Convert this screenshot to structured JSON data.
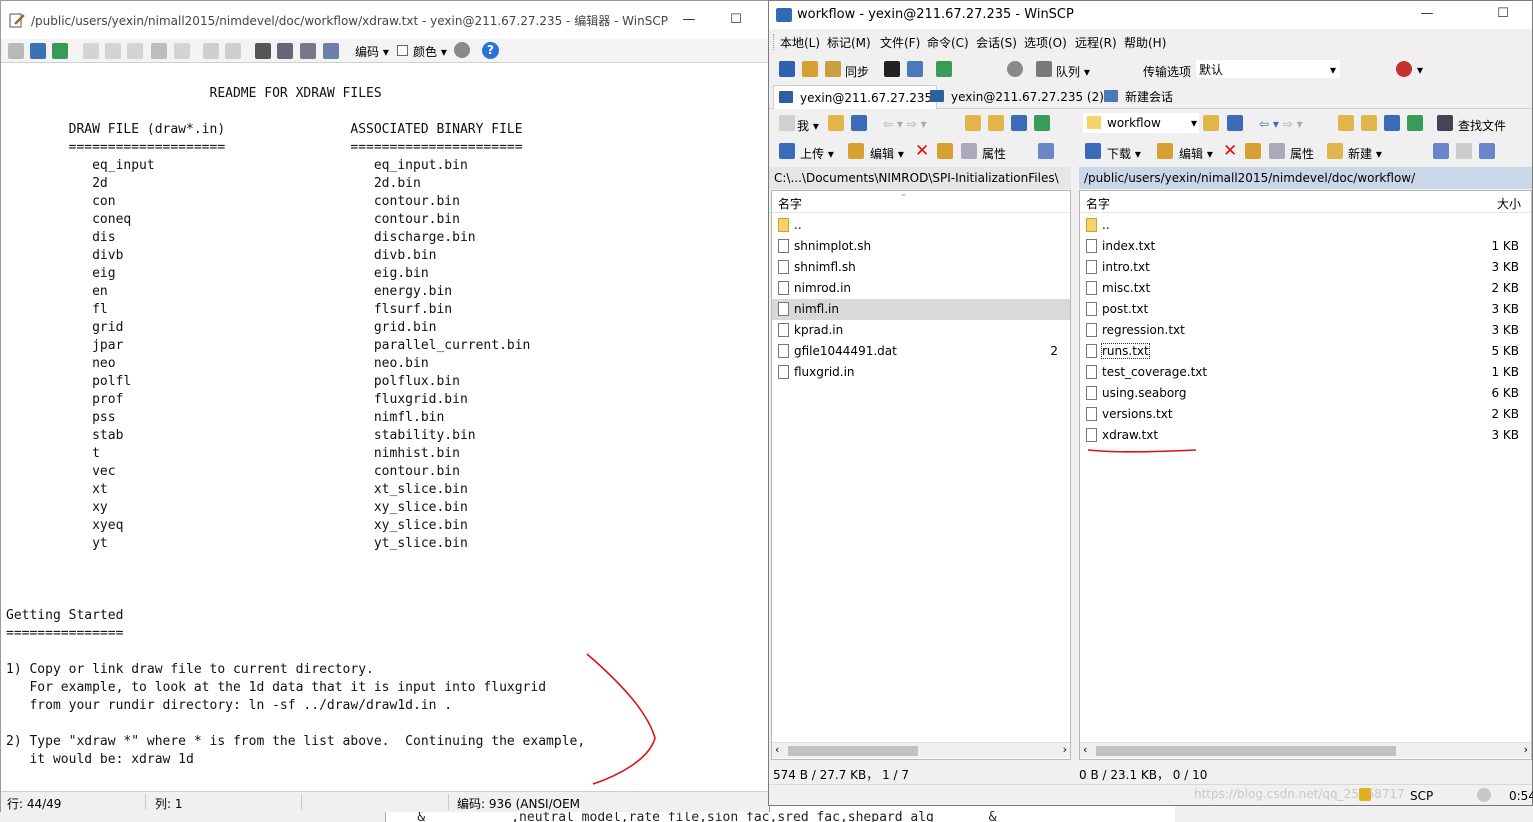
{
  "background": {
    "snippet": "  &           ,neutral_model,rate_file,sion_fac,sred_fac,shepard_alg       &"
  },
  "editor": {
    "title": "/public/users/yexin/nimall2015/nimdevel/doc/workflow/xdraw.txt - yexin@211.67.27.235 - 编辑器 - WinSCP",
    "window_controls": {
      "minimize": "—",
      "maximize": "☐"
    },
    "toolbar": {
      "encoding": "编码",
      "color": "颜色",
      "help": "?"
    },
    "content": "                          README FOR XDRAW FILES\n\n        DRAW FILE (draw*.in)                ASSOCIATED BINARY FILE\n        ====================                ======================\n           eq_input                            eq_input.bin\n           2d                                  2d.bin\n           con                                 contour.bin\n           coneq                               contour.bin\n           dis                                 discharge.bin\n           divb                                divb.bin\n           eig                                 eig.bin\n           en                                  energy.bin\n           fl                                  flsurf.bin\n           grid                                grid.bin\n           jpar                                parallel_current.bin\n           neo                                 neo.bin\n           polfl                               polflux.bin\n           prof                                fluxgrid.bin\n           pss                                 nimfl.bin\n           stab                                stability.bin\n           t                                   nimhist.bin\n           vec                                 contour.bin\n           xt                                  xt_slice.bin\n           xy                                  xy_slice.bin\n           xyeq                                xy_slice.bin\n           yt                                  yt_slice.bin\n\n\n\nGetting Started\n===============\n\n1) Copy or link draw file to current directory.\n   For example, to look at the 1d data that it is input into fluxgrid\n   from your rundir directory: ln -sf ../draw/draw1d.in .\n\n2) Type \"xdraw *\" where * is from the list above.  Continuing the example,\n   it would be: xdraw 1d",
    "status": {
      "line": "行: 44/49",
      "col": "列: 1",
      "encoding": "编码: 936  (ANSI/OEM"
    }
  },
  "winscp": {
    "title": "workflow - yexin@211.67.27.235 - WinSCP",
    "window_controls": {
      "minimize": "—",
      "maximize": "☐"
    },
    "menu": [
      "本地(L)",
      "标记(M)",
      "文件(F)",
      "命令(C)",
      "会话(S)",
      "选项(O)",
      "远程(R)",
      "帮助(H)"
    ],
    "toolbar": {
      "sync": "同步",
      "queue": "队列 ▾",
      "transfer_label": "传输选项",
      "transfer_value": "默认"
    },
    "tabs": [
      "yexin@211.67.27.235",
      "yexin@211.67.27.235 (2)",
      "新建会话"
    ],
    "local": {
      "location": "我",
      "upload": "上传",
      "edit": "编辑",
      "props": "属性",
      "path": "C:\\...\\Documents\\NIMROD\\SPI-InitializationFiles\\",
      "col_name": "名字",
      "files": [
        {
          "name": "..",
          "size": "",
          "type": "up"
        },
        {
          "name": "shnimplot.sh",
          "size": "",
          "type": "file"
        },
        {
          "name": "shnimfl.sh",
          "size": "",
          "type": "file"
        },
        {
          "name": "nimrod.in",
          "size": "",
          "type": "file"
        },
        {
          "name": "nimfl.in",
          "size": "",
          "type": "file",
          "selected": true
        },
        {
          "name": "kprad.in",
          "size": "",
          "type": "file"
        },
        {
          "name": "gfile1044491.dat",
          "size": "2",
          "type": "file"
        },
        {
          "name": "fluxgrid.in",
          "size": "",
          "type": "file"
        }
      ],
      "status": "574 B / 27.7 KB，  1 / 7"
    },
    "remote": {
      "location": "workflow",
      "download": "下载",
      "edit": "编辑",
      "props": "属性",
      "new": "新建",
      "find": "查找文件",
      "path": "/public/users/yexin/nimall2015/nimdevel/doc/workflow/",
      "col_name": "名字",
      "col_size": "大小",
      "files": [
        {
          "name": "..",
          "size": "",
          "type": "up"
        },
        {
          "name": "index.txt",
          "size": "1 KB",
          "type": "file"
        },
        {
          "name": "intro.txt",
          "size": "3 KB",
          "type": "file"
        },
        {
          "name": "misc.txt",
          "size": "2 KB",
          "type": "file"
        },
        {
          "name": "post.txt",
          "size": "3 KB",
          "type": "file"
        },
        {
          "name": "regression.txt",
          "size": "3 KB",
          "type": "file"
        },
        {
          "name": "runs.txt",
          "size": "5 KB",
          "type": "file"
        },
        {
          "name": "test_coverage.txt",
          "size": "1 KB",
          "type": "file"
        },
        {
          "name": "using.seaborg",
          "size": "6 KB",
          "type": "file"
        },
        {
          "name": "versions.txt",
          "size": "2 KB",
          "type": "file"
        },
        {
          "name": "xdraw.txt",
          "size": "3 KB",
          "type": "file"
        }
      ],
      "status": "0 B / 23.1 KB，  0 / 10"
    },
    "statusbar": {
      "protocol": "SCP",
      "time": "0:54",
      "watermark": "https://blog.csdn.net/qq_25568717"
    }
  },
  "colors": {
    "accent_red": "#e01010",
    "path_bar": "#c9d7e8",
    "help_blue": "#2a72d6"
  }
}
